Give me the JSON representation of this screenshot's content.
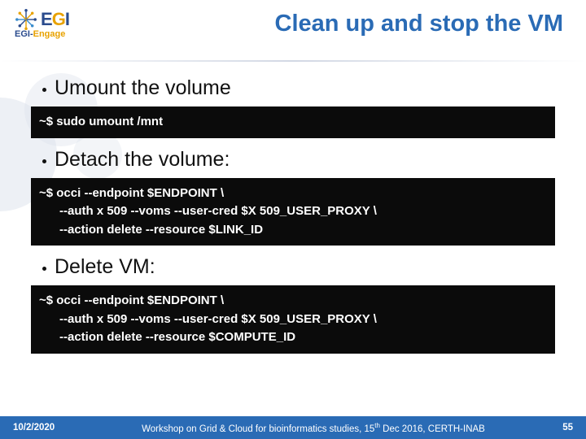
{
  "header": {
    "title": "Clean up and stop the VM",
    "logo": {
      "main_e": "E",
      "main_g": "G",
      "main_i": "I",
      "sub_egi": "EGI",
      "sub_dash": "-",
      "sub_engage": "Engage"
    }
  },
  "bullets": {
    "umount": "Umount the volume",
    "detach": "Detach the volume:",
    "delete": "Delete VM:"
  },
  "code": {
    "umount": "~$ sudo umount /mnt",
    "detach": "~$ occi --endpoint $ENDPOINT \\\n      --auth x 509 --voms --user-cred $X 509_USER_PROXY \\\n      --action delete --resource $LINK_ID",
    "delete": "~$ occi --endpoint $ENDPOINT \\\n      --auth x 509 --voms --user-cred $X 509_USER_PROXY \\\n      --action delete --resource $COMPUTE_ID"
  },
  "footer": {
    "date": "10/2/2020",
    "text_a": "Workshop on Grid & Cloud for bioinformatics studies, 15",
    "text_sup": "th",
    "text_b": "  Dec 2016, CERTH-INAB",
    "page": "55"
  }
}
